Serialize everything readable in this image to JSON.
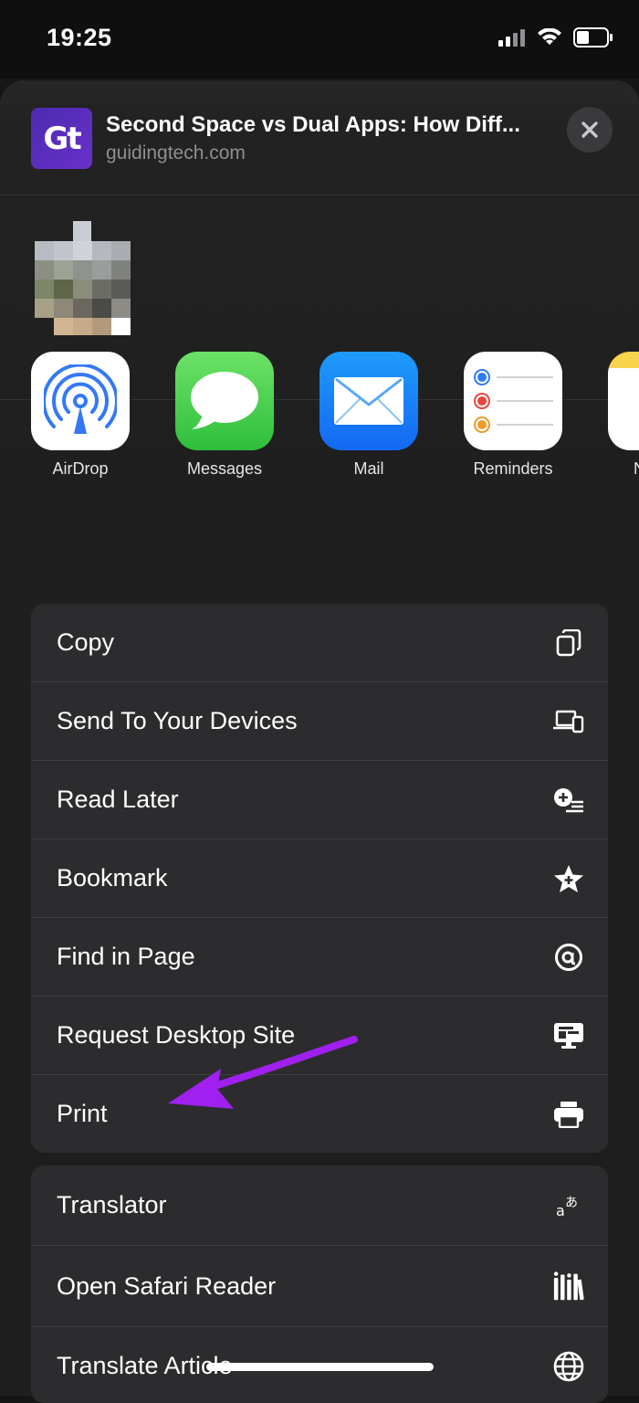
{
  "status_bar": {
    "time": "19:25"
  },
  "share_header": {
    "logo_text": "Gt",
    "title": "Second Space vs Dual Apps: How Diff...",
    "domain": "guidingtech.com"
  },
  "apps": [
    {
      "label": "AirDrop",
      "icon": "airdrop-icon"
    },
    {
      "label": "Messages",
      "icon": "messages-icon"
    },
    {
      "label": "Mail",
      "icon": "mail-icon"
    },
    {
      "label": "Reminders",
      "icon": "reminders-icon"
    },
    {
      "label": "N",
      "icon": "notes-icon"
    }
  ],
  "actions_group_1": [
    {
      "label": "Copy",
      "icon": "copy-icon"
    },
    {
      "label": "Send To Your Devices",
      "icon": "devices-icon"
    },
    {
      "label": "Read Later",
      "icon": "read-later-icon"
    },
    {
      "label": "Bookmark",
      "icon": "star-icon"
    },
    {
      "label": "Find in Page",
      "icon": "find-icon"
    },
    {
      "label": "Request Desktop Site",
      "icon": "desktop-icon"
    },
    {
      "label": "Print",
      "icon": "printer-icon"
    }
  ],
  "actions_group_2": [
    {
      "label": "Translator",
      "icon": "translate-icon"
    },
    {
      "label": "Open Safari Reader",
      "icon": "reader-icon"
    },
    {
      "label": "Translate Article",
      "icon": "globe-icon"
    }
  ],
  "colors": {
    "sheet_bg": "#1f1f1f",
    "row_bg": "#2c2c2e",
    "annotation_arrow": "#a020f0"
  }
}
